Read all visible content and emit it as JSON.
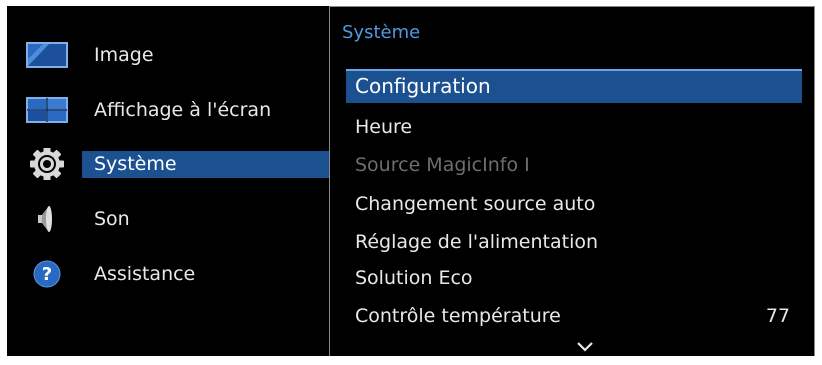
{
  "left_menu": {
    "items": [
      {
        "label": "Image",
        "icon": "picture-icon"
      },
      {
        "label": "Affichage à l'écran",
        "icon": "onscreen-display-icon"
      },
      {
        "label": "Système",
        "icon": "gear-icon",
        "selected": true
      },
      {
        "label": "Son",
        "icon": "speaker-icon"
      },
      {
        "label": "Assistance",
        "icon": "help-icon"
      }
    ]
  },
  "submenu": {
    "title": "Système",
    "items": [
      {
        "label": "Configuration",
        "selected": true
      },
      {
        "label": "Heure"
      },
      {
        "label": "Source MagicInfo I",
        "disabled": true
      },
      {
        "label": "Changement source auto"
      },
      {
        "label": "Réglage de l'alimentation"
      },
      {
        "label": "Solution Eco"
      },
      {
        "label": "Contrôle température",
        "value": "77"
      }
    ],
    "scroll_icon": "chevron-down-icon"
  },
  "colors": {
    "selection": "#1c5191",
    "title": "#4f9ae0",
    "text": "#e8e8e8",
    "disabled_text": "#6e6e6e"
  }
}
